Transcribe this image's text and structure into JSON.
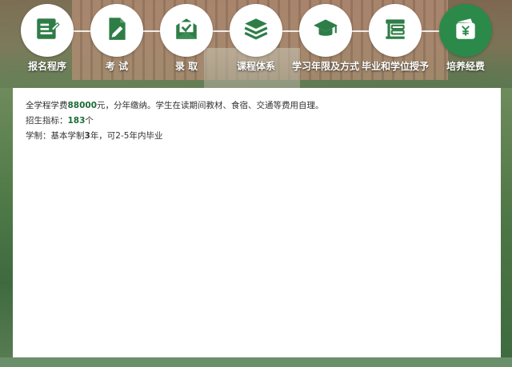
{
  "nav": {
    "items": [
      {
        "label": "报名程序",
        "icon": "edit-form-icon",
        "active": false
      },
      {
        "label": "考 试",
        "icon": "document-pen-icon",
        "active": false
      },
      {
        "label": "录 取",
        "icon": "envelope-check-icon",
        "active": false
      },
      {
        "label": "课程体系",
        "icon": "layers-icon",
        "active": false
      },
      {
        "label": "学习年限及方式",
        "icon": "graduation-cap-icon",
        "active": false
      },
      {
        "label": "毕业和学位授予",
        "icon": "books-icon",
        "active": false
      },
      {
        "label": "培养经费",
        "icon": "wallet-yuan-icon",
        "active": true
      }
    ]
  },
  "content": {
    "fee": {
      "prefix": "全学程学费",
      "amount": "88000",
      "suffix": "元，分年缴纳。学生在读期间教材、食宿、交通等费用自理。"
    },
    "enrollment": {
      "prefix": "招生指标：",
      "count": "183",
      "suffix": "个"
    },
    "duration": {
      "prefix": "学制：基本学制",
      "years": "3",
      "suffix": "年，可2-5年内毕业"
    }
  },
  "colors": {
    "accent_green": "#2b8a4a",
    "highlight_text": "#1e6b3a",
    "icon_green": "#2e7d46"
  }
}
